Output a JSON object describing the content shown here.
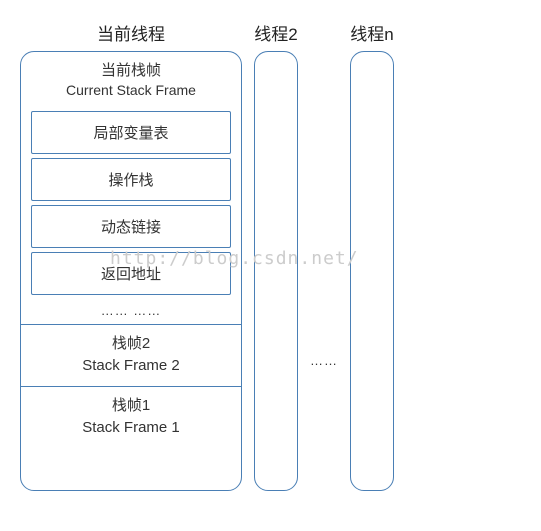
{
  "threads": {
    "current": {
      "title": "当前线程",
      "current_frame": {
        "label_cn": "当前栈帧",
        "label_en": "Current Stack Frame",
        "items": {
          "local_vars": "局部变量表",
          "operand_stack": "操作栈",
          "dynamic_link": "动态链接",
          "return_addr": "返回地址"
        },
        "ellipsis": "…… ……"
      },
      "frame2": {
        "label_cn": "栈帧2",
        "label_en": "Stack Frame 2"
      },
      "frame1": {
        "label_cn": "栈帧1",
        "label_en": "Stack Frame 1"
      }
    },
    "thread2": {
      "title": "线程2"
    },
    "threadn": {
      "title": "线程n"
    },
    "between_ellipsis": "……"
  },
  "watermark": "http://blog.csdn.net/"
}
